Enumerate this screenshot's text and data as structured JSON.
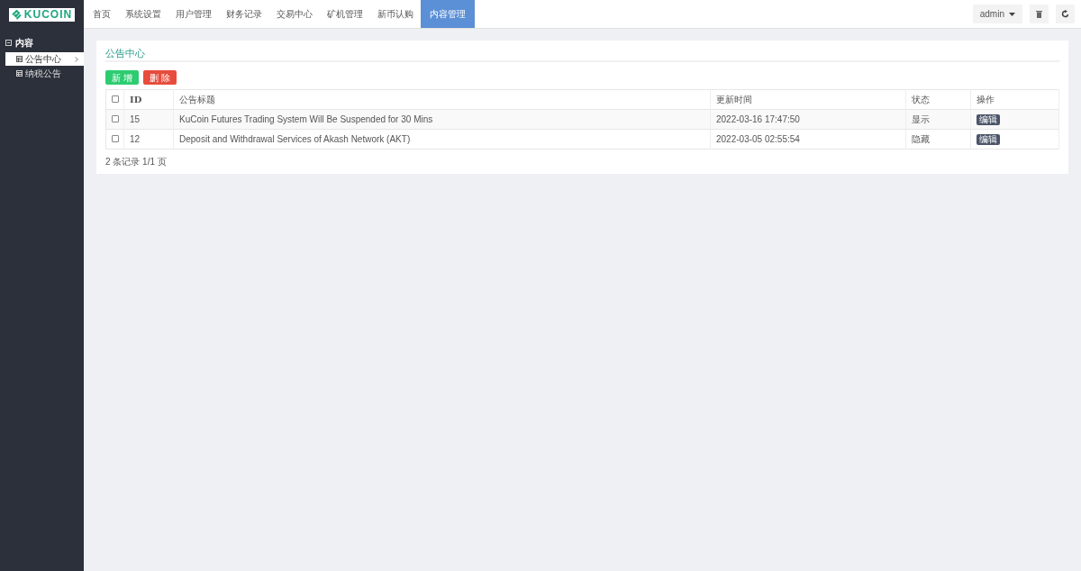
{
  "logo": {
    "text": "KUCOIN"
  },
  "nav": [
    {
      "label": "首页",
      "selected": false
    },
    {
      "label": "系统设置",
      "selected": false
    },
    {
      "label": "用户管理",
      "selected": false
    },
    {
      "label": "财务记录",
      "selected": false
    },
    {
      "label": "交易中心",
      "selected": false
    },
    {
      "label": "矿机管理",
      "selected": false
    },
    {
      "label": "新币认购",
      "selected": false
    },
    {
      "label": "内容管理",
      "selected": true
    }
  ],
  "user_menu": {
    "label": "admin"
  },
  "sidebar": {
    "group": {
      "label": "内容",
      "expanded": true,
      "children": [
        {
          "label": "公告中心",
          "selected": true
        },
        {
          "label": "纳税公告",
          "selected": false
        }
      ]
    }
  },
  "panel": {
    "title": "公告中心",
    "buttons": [
      {
        "label": "新 增",
        "kind": "add"
      },
      {
        "label": "删 除",
        "kind": "delete"
      }
    ],
    "table": {
      "all_checked": false,
      "columns": [
        "ID",
        "公告标题",
        "更新时间",
        "状态",
        "操作"
      ],
      "rows": [
        {
          "checked": false,
          "cells": [
            "15",
            "KuCoin Futures Trading System Will Be Suspended for 30 Mins",
            "2022-03-16 17:47:50",
            "显示",
            "编辑"
          ]
        },
        {
          "checked": false,
          "cells": [
            "12",
            "Deposit and Withdrawal Services of Akash Network (AKT)",
            "2022-03-05 02:55:54",
            "隐藏",
            "编辑"
          ]
        }
      ]
    },
    "pagination": "2 条记录 1/1 页"
  }
}
